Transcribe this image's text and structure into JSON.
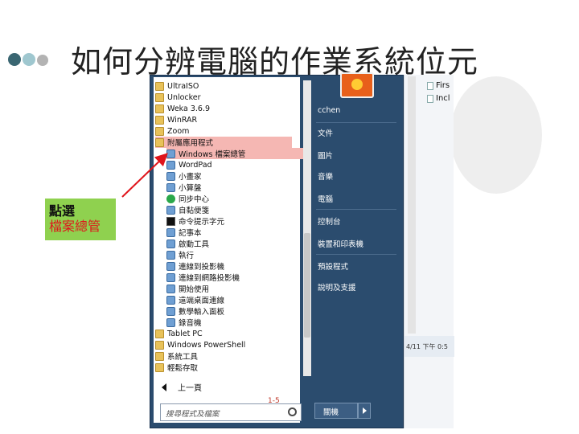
{
  "title": "如何分辨電腦的作業系統位元",
  "callout": {
    "line1": "點選",
    "line2": "檔案總管"
  },
  "start_menu": {
    "programs": [
      {
        "label": "UltraISO",
        "icon": "folder-icon"
      },
      {
        "label": "Unlocker",
        "icon": "folder-icon"
      },
      {
        "label": "Weka 3.6.9",
        "icon": "folder-icon"
      },
      {
        "label": "WinRAR",
        "icon": "folder-icon"
      },
      {
        "label": "Zoom",
        "icon": "folder-icon"
      },
      {
        "label": "附屬應用程式",
        "icon": "folder-icon"
      },
      {
        "label": "Windows 檔案總管",
        "icon": "explorer-icon"
      },
      {
        "label": "WordPad",
        "icon": "app-icon"
      },
      {
        "label": "小畫家",
        "icon": "app-icon"
      },
      {
        "label": "小算盤",
        "icon": "app-icon"
      },
      {
        "label": "同步中心",
        "icon": "sync-icon"
      },
      {
        "label": "自黏便箋",
        "icon": "app-icon"
      },
      {
        "label": "命令提示字元",
        "icon": "terminal-icon"
      },
      {
        "label": "記事本",
        "icon": "app-icon"
      },
      {
        "label": "啟動工具",
        "icon": "app-icon"
      },
      {
        "label": "執行",
        "icon": "app-icon"
      },
      {
        "label": "連線到投影機",
        "icon": "app-icon"
      },
      {
        "label": "連線到網路投影機",
        "icon": "app-icon"
      },
      {
        "label": "開始使用",
        "icon": "app-icon"
      },
      {
        "label": "遠端桌面連線",
        "icon": "app-icon"
      },
      {
        "label": "數學輸入面板",
        "icon": "app-icon"
      },
      {
        "label": "錄音機",
        "icon": "app-icon"
      },
      {
        "label": "Tablet PC",
        "icon": "folder-icon"
      },
      {
        "label": "Windows PowerShell",
        "icon": "folder-icon"
      },
      {
        "label": "系統工具",
        "icon": "folder-icon"
      },
      {
        "label": "輕鬆存取",
        "icon": "folder-icon"
      }
    ],
    "back_label": "上一頁",
    "search_placeholder": "搜尋程式及檔案",
    "page_marker": "1-5",
    "right_items": [
      "cchen",
      "文件",
      "圖片",
      "音樂",
      "電腦",
      "控制台",
      "裝置和印表機",
      "預設程式",
      "說明及支援"
    ],
    "shutdown_label": "關機"
  },
  "explorer": {
    "files": [
      "Firs",
      "Incl"
    ],
    "status": "4/11 下午 0:5"
  },
  "colors": {
    "menu_bg": "#2b4c6e",
    "highlight": "#f5b7b3",
    "callout_bg": "#8fd14f",
    "callout_red": "#e0141b"
  }
}
